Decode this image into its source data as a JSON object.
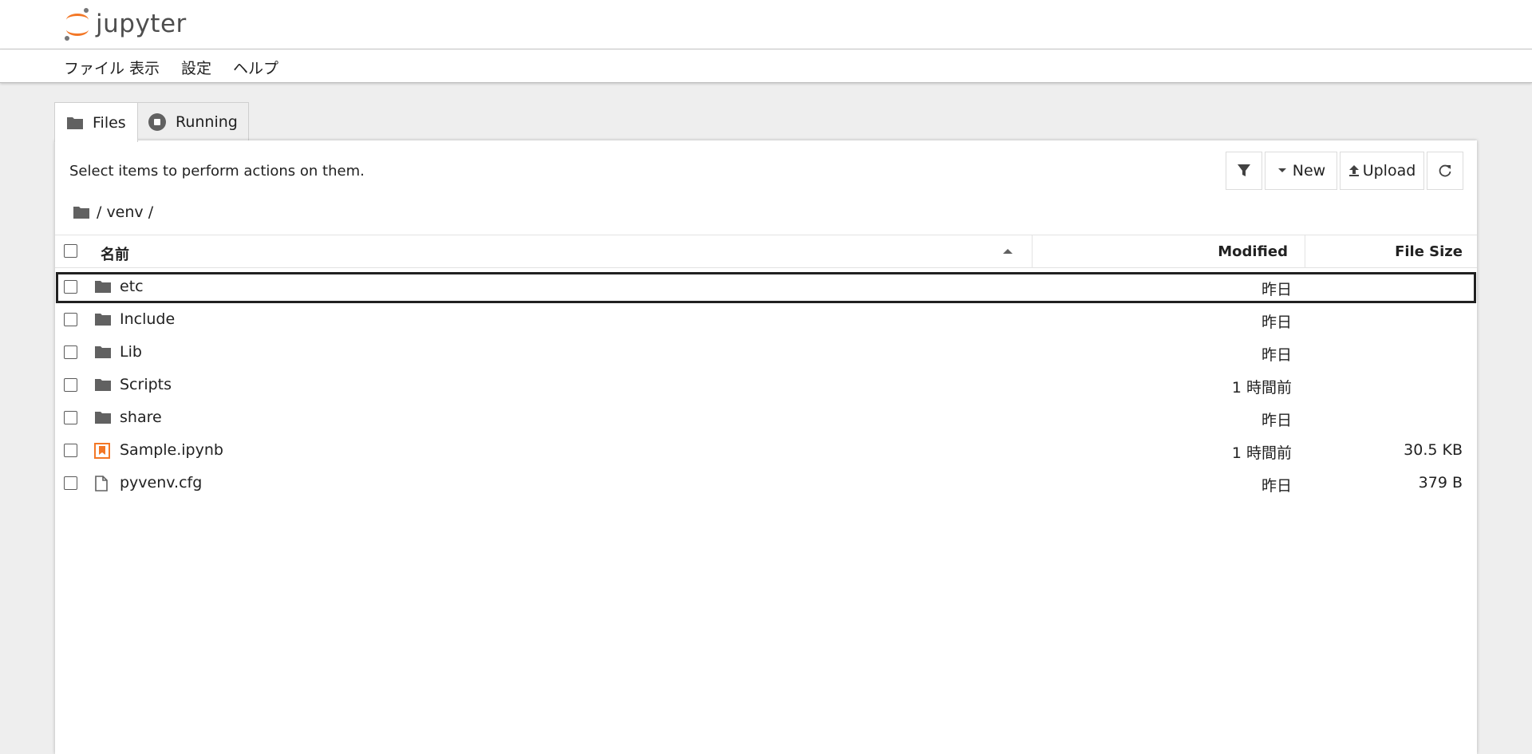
{
  "app": {
    "logo_text": "jupyter"
  },
  "menu": {
    "items": [
      "ファイル",
      "表示",
      "設定",
      "ヘルプ"
    ]
  },
  "tabs": [
    {
      "label": "Files",
      "active": true
    },
    {
      "label": "Running",
      "active": false
    }
  ],
  "toolbar": {
    "hint": "Select items to perform actions on them.",
    "new_label": "New",
    "upload_label": "Upload"
  },
  "breadcrumb": {
    "path": "/ venv /"
  },
  "table": {
    "headers": {
      "name": "名前",
      "modified": "Modified",
      "size": "File Size"
    },
    "sort": "name-ascending",
    "rows": [
      {
        "name": "etc",
        "type": "folder",
        "modified": "昨日",
        "size": ""
      },
      {
        "name": "Include",
        "type": "folder",
        "modified": "昨日",
        "size": ""
      },
      {
        "name": "Lib",
        "type": "folder",
        "modified": "昨日",
        "size": ""
      },
      {
        "name": "Scripts",
        "type": "folder",
        "modified": "1 時間前",
        "size": ""
      },
      {
        "name": "share",
        "type": "folder",
        "modified": "昨日",
        "size": ""
      },
      {
        "name": "Sample.ipynb",
        "type": "notebook",
        "modified": "1 時間前",
        "size": "30.5 KB"
      },
      {
        "name": "pyvenv.cfg",
        "type": "file",
        "modified": "昨日",
        "size": "379 B"
      }
    ]
  },
  "colors": {
    "brand_orange": "#f37726",
    "icon_gray": "#616161",
    "text": "#212121"
  },
  "icons": {
    "folder": "folder-icon",
    "notebook": "notebook-icon",
    "file": "file-icon",
    "filter": "filter-icon",
    "new": "caret-down-icon",
    "upload": "upload-icon",
    "refresh": "refresh-icon",
    "sort": "sort-up-icon",
    "running": "stop-circle-icon"
  }
}
